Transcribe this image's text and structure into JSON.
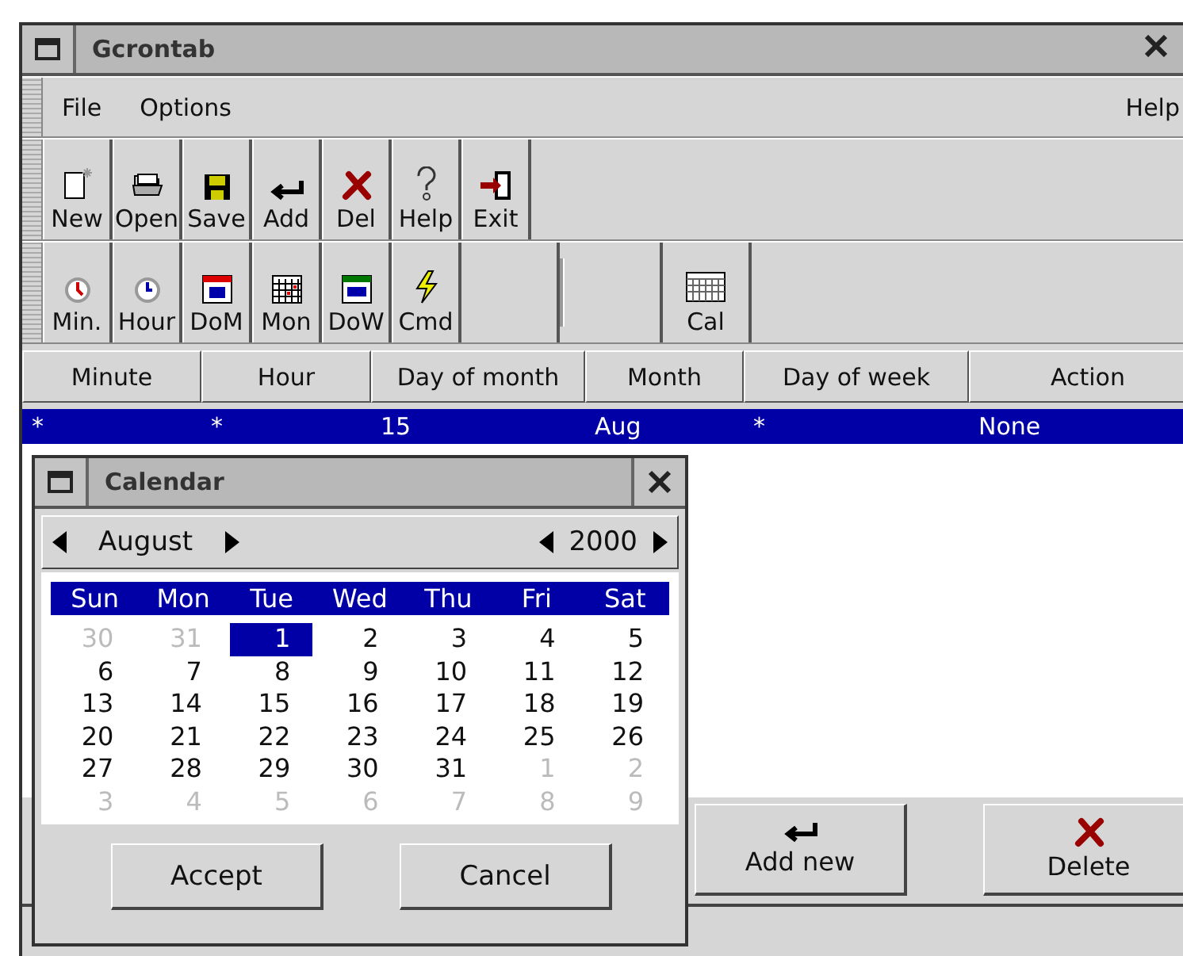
{
  "window": {
    "title": "Gcrontab"
  },
  "menu": {
    "left": [
      "File",
      "Options"
    ],
    "right": "Help"
  },
  "toolbar": [
    "New",
    "Open",
    "Save",
    "Add",
    "Del",
    "Help",
    "Exit"
  ],
  "field_toolbar": [
    "Min.",
    "Hour",
    "DoM",
    "Mon",
    "DoW",
    "Cmd"
  ],
  "cal_button": "Cal",
  "table": {
    "columns": [
      "Minute",
      "Hour",
      "Day of month",
      "Month",
      "Day of week",
      "Action"
    ],
    "rows": [
      {
        "selected": true,
        "cells": [
          "*",
          "*",
          "15",
          "Aug",
          "*",
          "None"
        ]
      }
    ]
  },
  "actions": [
    "Add new",
    "Delete"
  ],
  "calendar": {
    "title": "Calendar",
    "month": "August",
    "year": "2000",
    "weekdays": [
      "Sun",
      "Mon",
      "Tue",
      "Wed",
      "Thu",
      "Fri",
      "Sat"
    ],
    "days": [
      {
        "label": "30",
        "other_month": true,
        "selected": false
      },
      {
        "label": "31",
        "other_month": true,
        "selected": false
      },
      {
        "label": "1",
        "other_month": false,
        "selected": true
      },
      {
        "label": "2",
        "other_month": false,
        "selected": false
      },
      {
        "label": "3",
        "other_month": false,
        "selected": false
      },
      {
        "label": "4",
        "other_month": false,
        "selected": false
      },
      {
        "label": "5",
        "other_month": false,
        "selected": false
      },
      {
        "label": "6",
        "other_month": false,
        "selected": false
      },
      {
        "label": "7",
        "other_month": false,
        "selected": false
      },
      {
        "label": "8",
        "other_month": false,
        "selected": false
      },
      {
        "label": "9",
        "other_month": false,
        "selected": false
      },
      {
        "label": "10",
        "other_month": false,
        "selected": false
      },
      {
        "label": "11",
        "other_month": false,
        "selected": false
      },
      {
        "label": "12",
        "other_month": false,
        "selected": false
      },
      {
        "label": "13",
        "other_month": false,
        "selected": false
      },
      {
        "label": "14",
        "other_month": false,
        "selected": false
      },
      {
        "label": "15",
        "other_month": false,
        "selected": false
      },
      {
        "label": "16",
        "other_month": false,
        "selected": false
      },
      {
        "label": "17",
        "other_month": false,
        "selected": false
      },
      {
        "label": "18",
        "other_month": false,
        "selected": false
      },
      {
        "label": "19",
        "other_month": false,
        "selected": false
      },
      {
        "label": "20",
        "other_month": false,
        "selected": false
      },
      {
        "label": "21",
        "other_month": false,
        "selected": false
      },
      {
        "label": "22",
        "other_month": false,
        "selected": false
      },
      {
        "label": "23",
        "other_month": false,
        "selected": false
      },
      {
        "label": "24",
        "other_month": false,
        "selected": false
      },
      {
        "label": "25",
        "other_month": false,
        "selected": false
      },
      {
        "label": "26",
        "other_month": false,
        "selected": false
      },
      {
        "label": "27",
        "other_month": false,
        "selected": false
      },
      {
        "label": "28",
        "other_month": false,
        "selected": false
      },
      {
        "label": "29",
        "other_month": false,
        "selected": false
      },
      {
        "label": "30",
        "other_month": false,
        "selected": false
      },
      {
        "label": "31",
        "other_month": false,
        "selected": false
      },
      {
        "label": "1",
        "other_month": true,
        "selected": false
      },
      {
        "label": "2",
        "other_month": true,
        "selected": false
      },
      {
        "label": "3",
        "other_month": true,
        "selected": false
      },
      {
        "label": "4",
        "other_month": true,
        "selected": false
      },
      {
        "label": "5",
        "other_month": true,
        "selected": false
      },
      {
        "label": "6",
        "other_month": true,
        "selected": false
      },
      {
        "label": "7",
        "other_month": true,
        "selected": false
      },
      {
        "label": "8",
        "other_month": true,
        "selected": false
      },
      {
        "label": "9",
        "other_month": true,
        "selected": false
      }
    ],
    "buttons": [
      "Accept",
      "Cancel"
    ]
  }
}
